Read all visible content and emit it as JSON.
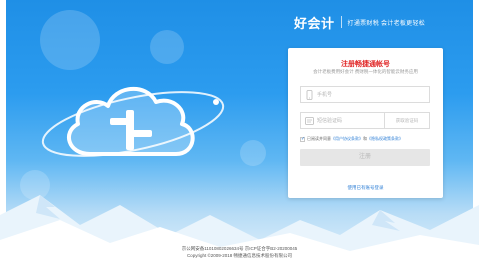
{
  "brand": {
    "logo_text": "好会计",
    "slogan": "打通票财税 会计老板更轻松"
  },
  "card": {
    "title": "注册畅捷通帐号",
    "subtitle": "会计老板费用好会计 费财税一体化的智能云财务应用",
    "phone_placeholder": "手机号",
    "code_placeholder": "短信验证码",
    "code_button": "获取验证码",
    "agree_prefix": "已阅读并同意",
    "agree_link1": "《用户协议条款》",
    "agree_and": "和",
    "agree_link2": "《隐私权政策条款》",
    "submit_label": "注册",
    "login_link": "使用已有账号登录"
  },
  "footer": {
    "line1": "京公网安备11010802026634号 京ICP证合字B2-20200045",
    "line2": "Copyright ©2009-2018 畅捷通信息技术股份有限公司"
  },
  "colors": {
    "accent": "#2e7fd6",
    "title_red": "#e02424",
    "bg_blue": "#2c9cef"
  }
}
